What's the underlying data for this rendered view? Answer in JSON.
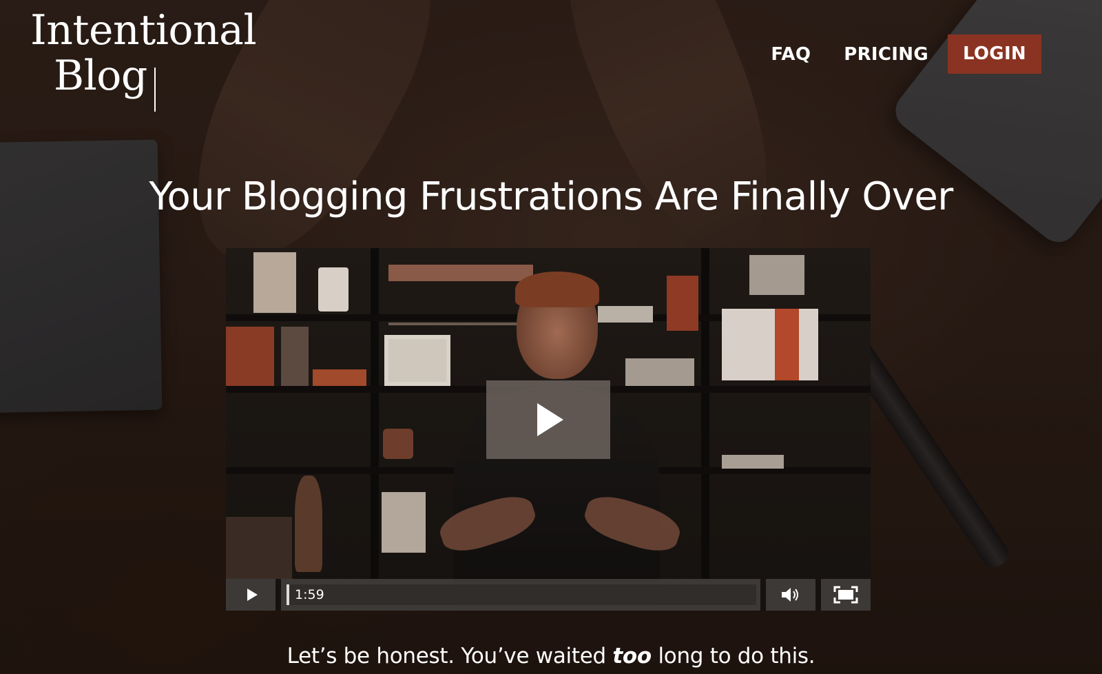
{
  "brand": {
    "logo_line1": "Intentional",
    "logo_line2": "Blog"
  },
  "nav": {
    "faq": "FAQ",
    "pricing": "PRICING",
    "login": "LOGIN"
  },
  "hero": {
    "headline": "Your Blogging Frustrations Are Finally Over",
    "tagline_before": "Let’s be honest. You’ve waited ",
    "tagline_emphasis": "too",
    "tagline_after": " long to do this."
  },
  "video": {
    "duration": "1:59",
    "icons": [
      "play-icon",
      "play-small-icon",
      "volume-icon",
      "fullscreen-icon"
    ]
  },
  "colors": {
    "login_bg": "#8a3322",
    "background": "#2a1d16"
  }
}
